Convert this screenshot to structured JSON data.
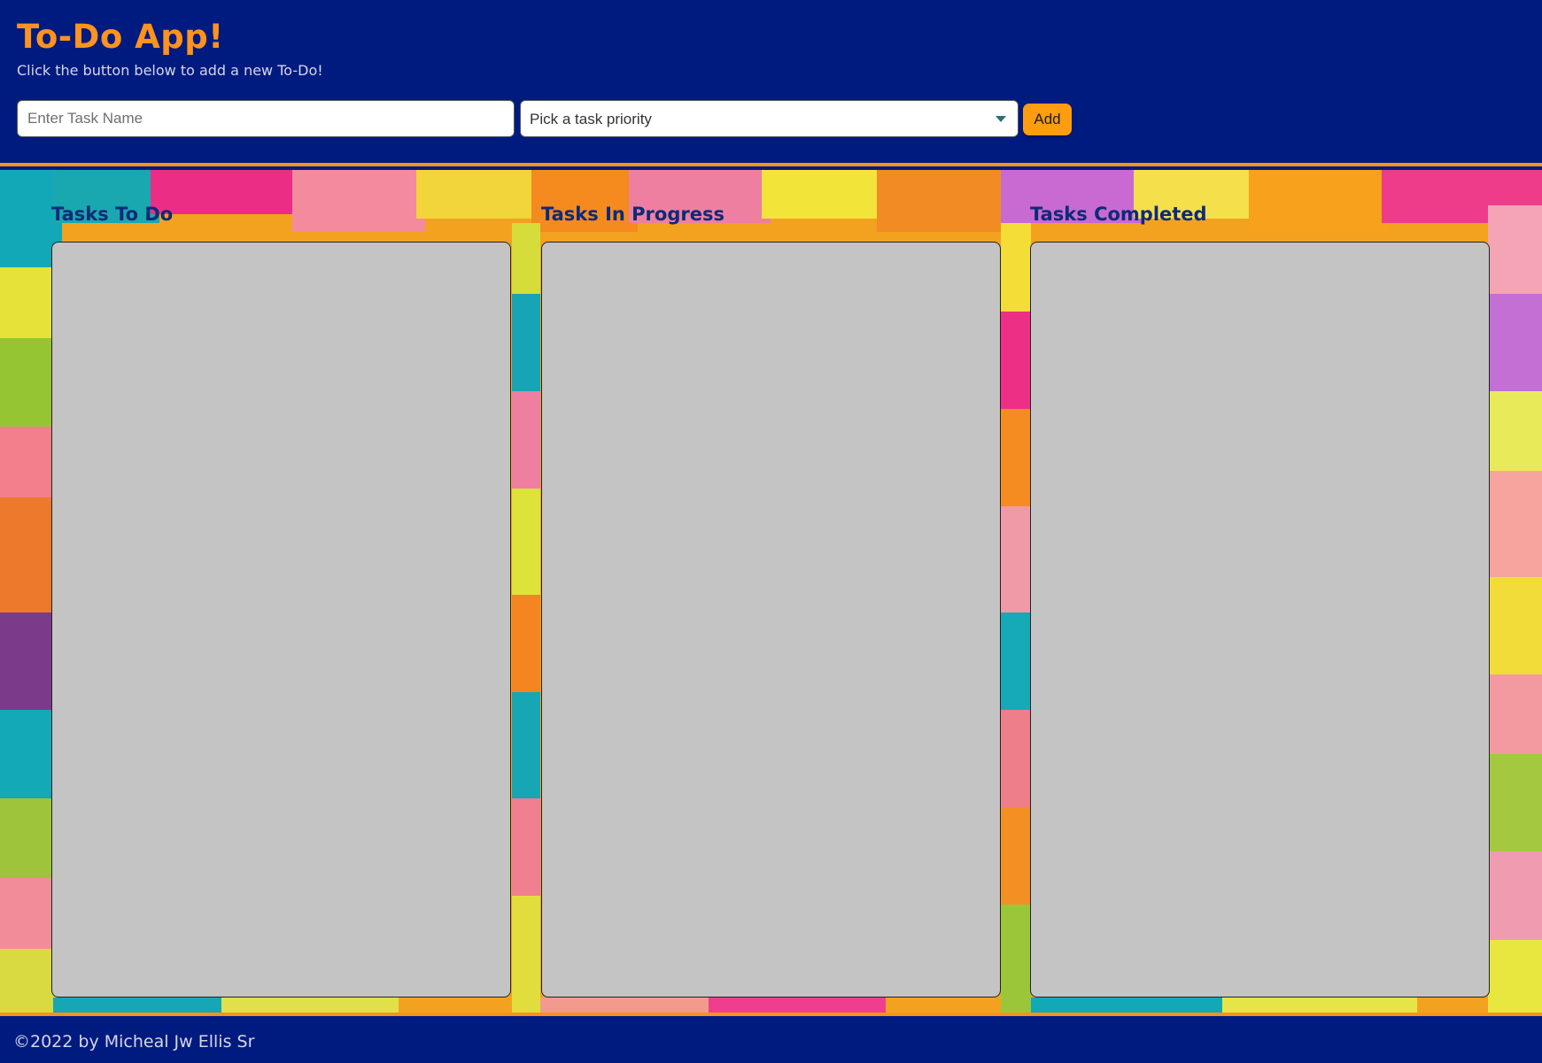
{
  "header": {
    "title": "To-Do App!",
    "subtitle": "Click the button below to add a new To-Do!",
    "task_input": {
      "placeholder": "Enter Task Name",
      "value": ""
    },
    "priority_select": {
      "selected": "Pick a task priority"
    },
    "add_label": "Add"
  },
  "columns": [
    {
      "title": "Tasks To Do",
      "tasks": []
    },
    {
      "title": "Tasks In Progress",
      "tasks": []
    },
    {
      "title": "Tasks Completed",
      "tasks": []
    }
  ],
  "footer": {
    "text": "©2022 by Micheal Jw Ellis Sr"
  },
  "colors": {
    "header_bg": "#001b80",
    "accent": "#ff931e",
    "column_bg": "#c4c4c4",
    "column_title": "#0d2a7a",
    "add_button": "#ff9d10"
  }
}
